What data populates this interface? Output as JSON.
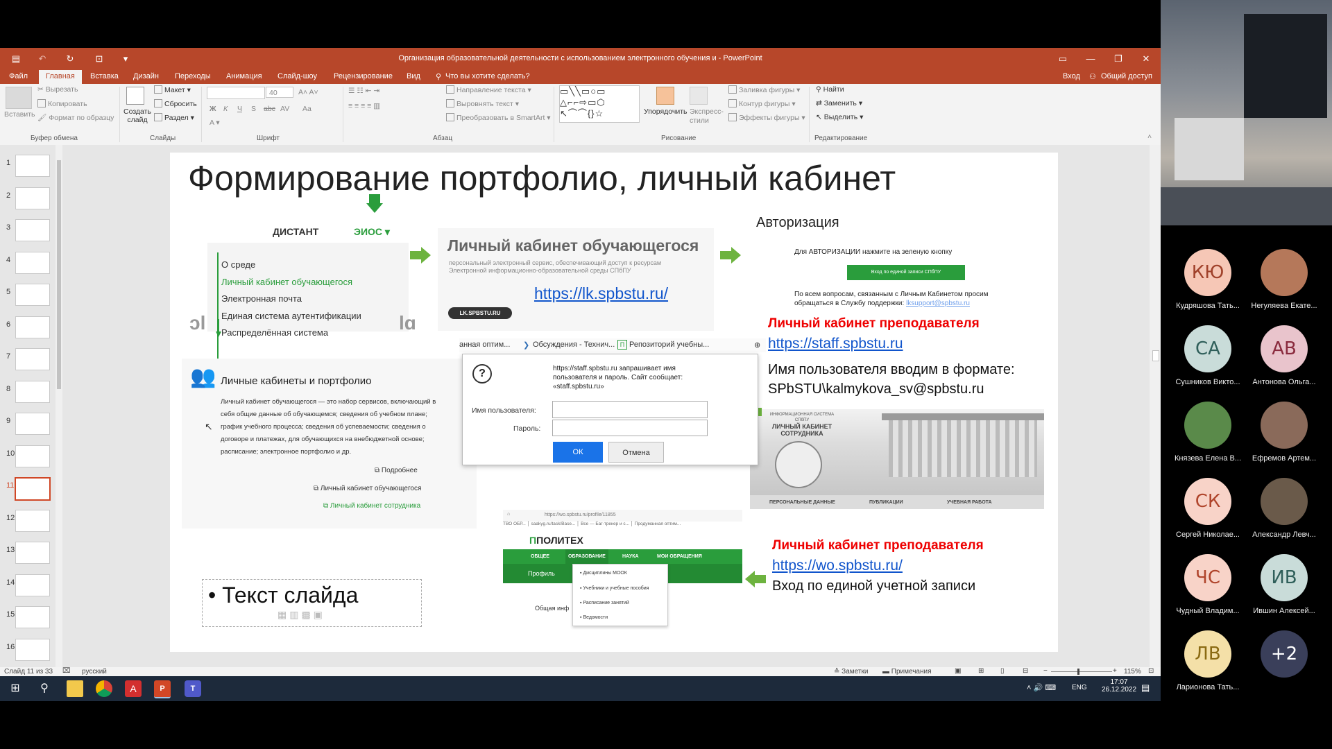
{
  "window": {
    "title": "Организация образовательной деятельности с использованием электронного обучения и - PowerPoint"
  },
  "menu": {
    "tabs": [
      "Файл",
      "Главная",
      "Вставка",
      "Дизайн",
      "Переходы",
      "Анимация",
      "Слайд-шоу",
      "Рецензирование",
      "Вид"
    ],
    "tellme": "Что вы хотите сделать?",
    "signin": "Вход",
    "share": "Общий доступ"
  },
  "ribbon": {
    "paste": "Вставить",
    "cut": "Вырезать",
    "copy": "Копировать",
    "format_painter": "Формат по образцу",
    "clipboard_group": "Буфер обмена",
    "new_slide": "Создать слайд",
    "layout": "Макет",
    "reset": "Сбросить",
    "section": "Раздел",
    "slides_group": "Слайды",
    "font_size": "40",
    "font_group": "Шрифт",
    "text_direction": "Направление текста",
    "align_text": "Выровнять текст",
    "smartart": "Преобразовать в SmartArt",
    "paragraph_group": "Абзац",
    "arrange": "Упорядочить",
    "quick_styles": "Экспресс-стили",
    "shape_fill": "Заливка фигуры",
    "shape_outline": "Контур фигуры",
    "shape_effects": "Эффекты фигуры",
    "drawing_group": "Рисование",
    "find": "Найти",
    "replace": "Заменить",
    "select": "Выделить",
    "editing_group": "Редактирование"
  },
  "thumbnails": [
    "1",
    "2",
    "3",
    "4",
    "5",
    "6",
    "7",
    "8",
    "9",
    "10",
    "11",
    "12",
    "13",
    "14",
    "15",
    "16"
  ],
  "selected_slide": "11",
  "slide": {
    "title": "Формирование портфолио, личный кабинет",
    "distant": "ДИСТАНТ",
    "eios": "ЭИОС ▾",
    "menu_items": [
      "О среде",
      "Личный кабинет обучающегося",
      "Электронная почта",
      "Единая система аутентификации",
      "Распределённая система"
    ],
    "lk_header": "Личный кабинет обучающегося",
    "lk_sub1": "персональный электронный сервис, обеспечивающий доступ к ресурсам",
    "lk_sub2": "Электронной информационно-образовательной среды СПбПУ",
    "lk_link": "https://lk.spbstu.ru/",
    "lk_badge": "LK.SPBSTU.RU",
    "auth_title": "Авторизация",
    "auth_text": "Для АВТОРИЗАЦИИ нажмите на зеленую кнопку",
    "auth_button": "Вход по единой записи СПбПУ",
    "auth_support1": "По всем вопросам, связанным с Личным Кабинетом просим",
    "auth_support2": "обращаться в Службу поддержки:",
    "auth_support_link": "lksupport@spbstu.ru",
    "portfolio_title": "Личные кабинеты и портфолио",
    "portfolio_text": "Личный кабинет обучающегося — это набор сервисов, включающий в себя общие данные об обучающемся; сведения об учебном плане; график учебного процесса; сведения об успеваемости; сведения о договоре и платежах, для обучающихся на внебюджетной основе; расписание; электронное портфолио и др.",
    "more": "Подробнее",
    "portfolio_link1": "Личный кабинет обучающегося",
    "portfolio_link2": "Личный кабинет сотрудника",
    "bookmarks": [
      "анная оптим...",
      "Обсуждения - Технич...",
      "Репозиторий учебны..."
    ],
    "dialog_text": "https://staff.spbstu.ru запрашивает имя пользователя и пароль. Сайт сообщает: «staff.spbstu.ru»",
    "dialog_user": "Имя пользователя:",
    "dialog_pass": "Пароль:",
    "dialog_ok": "ОК",
    "dialog_cancel": "Отмена",
    "teacher_title": "Личный кабинет преподавателя",
    "staff_link": "https://staff.spbstu.ru",
    "login_format1": "Имя пользователя вводим в формате:",
    "login_format2": "SPbSTU\\kalmykova_sv@spbstu.ru",
    "building_caption1": "ИНФОРМАЦИОННАЯ СИСТЕМА СПбПУ",
    "building_caption2": "ЛИЧНЫЙ КАБИНЕТ СОТРУДНИКА",
    "building_tabs": [
      "ПЕРСОНАЛЬНЫЕ ДАННЫЕ",
      "ПУБЛИКАЦИИ",
      "УЧЕБНАЯ РАБОТА"
    ],
    "wo_url": "https://wo.spbstu.ru/profile/11855",
    "wo_bookmarks": "ТВО ОБР... │ saakyg.ru/task/Base... │ Все — Баг-трекер и с... │ Продуманная оптим...",
    "wo_logo": "ПОЛИТЕХ",
    "wo_nav": [
      "ОБЩЕЕ",
      "ОБРАЗОВАНИЕ",
      "НАУКА",
      "МОИ ОБРАЩЕНИЯ"
    ],
    "wo_profile": "Профиль",
    "wo_common": "Общая инф",
    "wo_dropdown": [
      "Дисциплины МООК",
      "Учебники и учебные пособия",
      "Расписание занятий",
      "Ведомости"
    ],
    "teacher_title2": "Личный кабинет преподавателя",
    "wo_link": "https://wo.spbstu.ru/",
    "wo_login": "Вход по единой учетной записи",
    "placeholder_text": "Текст слайда"
  },
  "status": {
    "slide_of": "Слайд 11 из 33",
    "lang": "русский",
    "notes": "Заметки",
    "comments": "Примечания",
    "zoom": "115%"
  },
  "taskbar": {
    "lang": "ENG",
    "time": "17:07",
    "date": "26.12.2022"
  },
  "participants": [
    {
      "initials": "КЮ",
      "name": "Кудряшова Тать...",
      "color": "#f6c7b6",
      "text_color": "#a0412a"
    },
    {
      "initials": "",
      "name": "Негуляева Екате...",
      "color": "#b5785a",
      "text_color": "#fff"
    },
    {
      "initials": "СА",
      "name": "Сушников Викто...",
      "color": "#c9dcd9",
      "text_color": "#2f5f5a"
    },
    {
      "initials": "АВ",
      "name": "Антонова Ольга...",
      "color": "#e9c4cc",
      "text_color": "#8a2b3e"
    },
    {
      "initials": "",
      "name": "Князева Елена В...",
      "color": "#5a8a4a",
      "text_color": "#fff"
    },
    {
      "initials": "",
      "name": "Ефремов Артем...",
      "color": "#8a6a5a",
      "text_color": "#fff"
    },
    {
      "initials": "СК",
      "name": "Сергей Николае...",
      "color": "#f8d3c8",
      "text_color": "#b0452c"
    },
    {
      "initials": "",
      "name": "Александр Левч...",
      "color": "#6a5a4a",
      "text_color": "#fff"
    },
    {
      "initials": "ЧС",
      "name": "Чудный Владим...",
      "color": "#f8d3c8",
      "text_color": "#b0452c"
    },
    {
      "initials": "ИВ",
      "name": "Ившин Алексей...",
      "color": "#c9dcd9",
      "text_color": "#2f5f5a"
    },
    {
      "initials": "ЛВ",
      "name": "Ларионова Тать...",
      "color": "#f4e0a8",
      "text_color": "#8a6a12"
    },
    {
      "initials": "+2",
      "name": "",
      "color": "#3a3f5a",
      "text_color": "#fff"
    }
  ]
}
